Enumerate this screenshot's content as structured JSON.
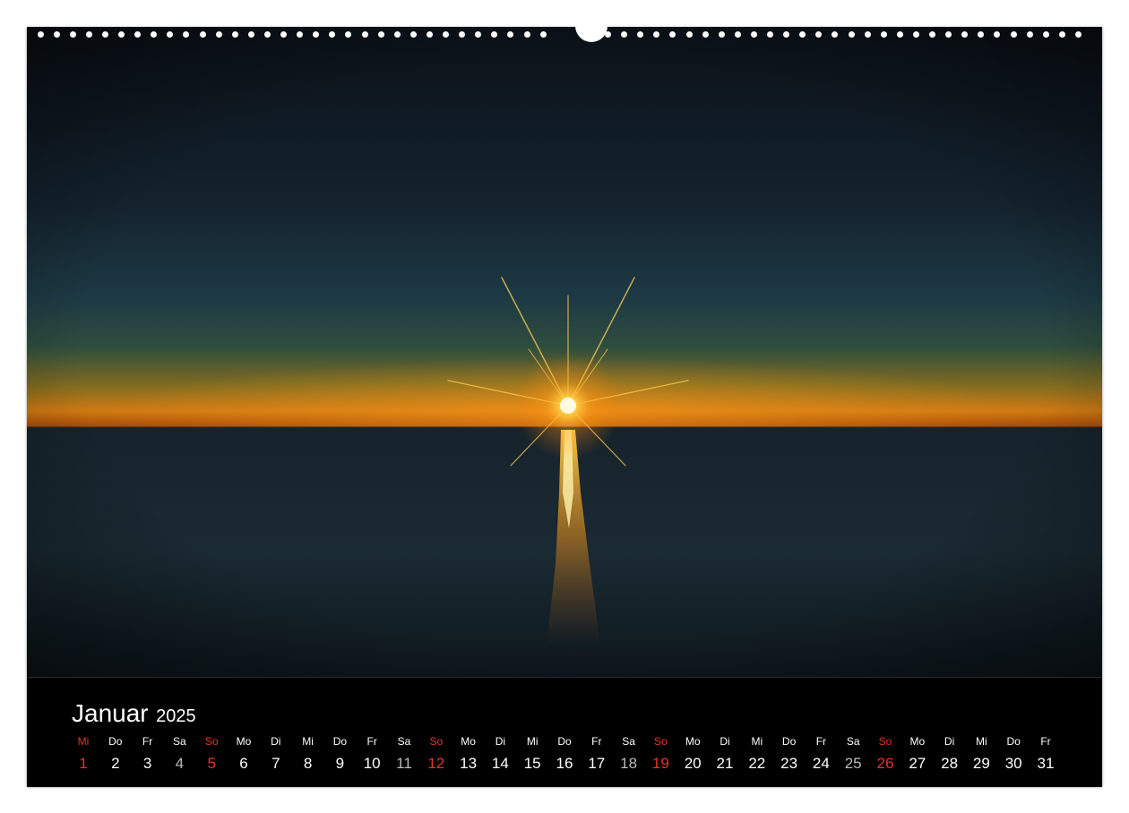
{
  "calendar": {
    "month": "Januar",
    "year": "2025",
    "weekdays": [
      "Mi",
      "Do",
      "Fr",
      "Sa",
      "So",
      "Mo",
      "Di",
      "Mi",
      "Do",
      "Fr",
      "Sa",
      "So",
      "Mo",
      "Di",
      "Mi",
      "Do",
      "Fr",
      "Sa",
      "So",
      "Mo",
      "Di",
      "Mi",
      "Do",
      "Fr",
      "Sa",
      "So",
      "Mo",
      "Di",
      "Mi",
      "Do",
      "Fr"
    ],
    "days": [
      "1",
      "2",
      "3",
      "4",
      "5",
      "6",
      "7",
      "8",
      "9",
      "10",
      "11",
      "12",
      "13",
      "14",
      "15",
      "16",
      "17",
      "18",
      "19",
      "20",
      "21",
      "22",
      "23",
      "24",
      "25",
      "26",
      "27",
      "28",
      "29",
      "30",
      "31"
    ],
    "highlighted_days": [
      "1",
      "5",
      "12",
      "19",
      "26"
    ],
    "saturday_days": [
      "4",
      "11",
      "18",
      "25"
    ]
  },
  "colors": {
    "background": "#000000",
    "text": "#ffffff",
    "sunday": "#e8332b",
    "saturday": "#bbbbbb",
    "sun_glow": "#ffb020"
  },
  "photo": {
    "subject": "sunset-over-sea-icon"
  }
}
